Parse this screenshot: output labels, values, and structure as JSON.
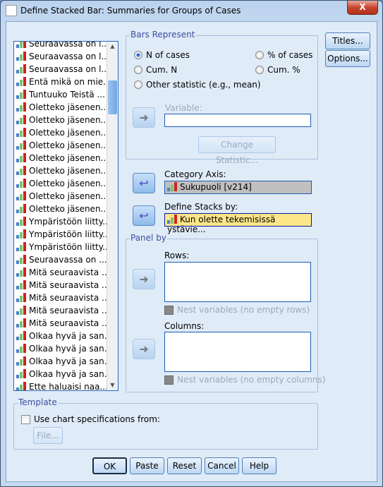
{
  "window": {
    "title": "Define Stacked Bar: Summaries for Groups of Cases",
    "close": "X"
  },
  "variables": [
    "Seuraavassa on l...",
    "Seuraavassa on l...",
    "Seuraavassa on l...",
    "Entä mikä on mie...",
    "Tuntuuko Teistä ...",
    "Oletteko jäsenen...",
    "Oletteko jäsenen...",
    "Oletteko jäsenen...",
    "Oletteko jäsenen...",
    "Oletteko jäsenen...",
    "Oletteko jäsenen...",
    "Oletteko jäsenen...",
    "Oletteko jäsenen...",
    "Oletteko jäsenen...",
    "Ympäristöön liitty...",
    "Ympäristöön liitty...",
    "Ympäristöön liitty...",
    "Seuraavassa on ...",
    "Mitä seuraavista ...",
    "Mitä seuraavista ...",
    "Mitä seuraavista ...",
    "Mitä seuraavista ...",
    "Mitä seuraavista ...",
    "Olkaa hyvä ja san...",
    "Olkaa hyvä ja san...",
    "Olkaa hyvä ja san...",
    "Olkaa hyvä ja san...",
    "Ette haluaisi naa..."
  ],
  "bars": {
    "legend": "Bars Represent",
    "options": [
      "N of cases",
      "% of cases",
      "Cum. N",
      "Cum. %",
      "Other statistic (e.g., mean)"
    ],
    "selected": "N of cases",
    "variable_label": "Variable:",
    "variable_value": "",
    "change_stat": "Change Statistic..."
  },
  "category_axis": {
    "label": "Category Axis:",
    "value": "Sukupuoli [v214]"
  },
  "stacks": {
    "label": "Define Stacks by:",
    "value": "Kun olette tekemisissä ystävie..."
  },
  "panel": {
    "legend": "Panel by",
    "rows": "Rows:",
    "nest_rows": "Nest variables (no empty rows)",
    "columns": "Columns:",
    "nest_cols": "Nest variables (no empty columns)"
  },
  "template": {
    "legend": "Template",
    "use": "Use chart specifications from:",
    "file": "File..."
  },
  "side": {
    "titles": "Titles...",
    "options": "Options..."
  },
  "buttons": {
    "ok": "OK",
    "paste": "Paste",
    "reset": "Reset",
    "cancel": "Cancel",
    "help": "Help"
  },
  "colors": {
    "selected_field": "#fde68a",
    "category_field": "#c0c0c0",
    "legend_text": "#3c4fa0"
  }
}
